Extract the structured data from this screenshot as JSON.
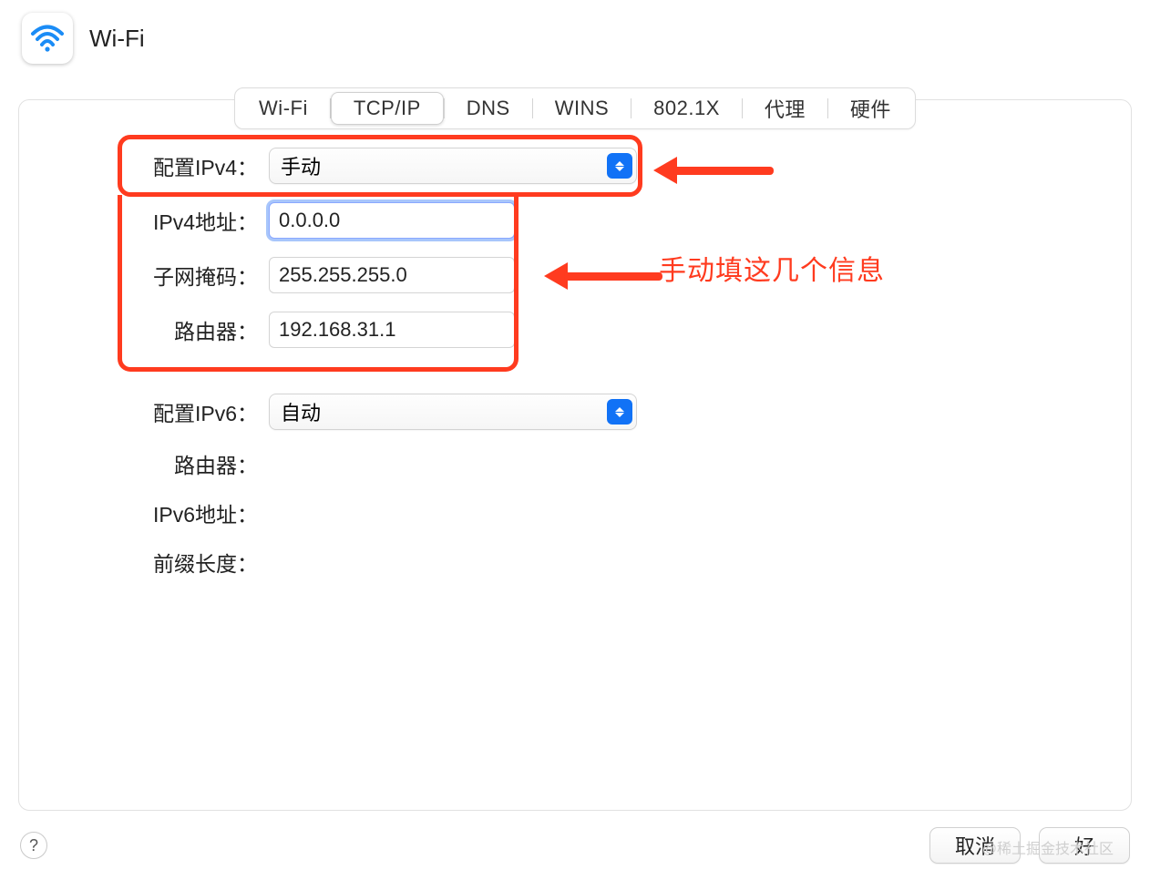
{
  "header": {
    "title": "Wi-Fi"
  },
  "tabs": {
    "items": [
      {
        "label": "Wi-Fi",
        "active": false
      },
      {
        "label": "TCP/IP",
        "active": true
      },
      {
        "label": "DNS",
        "active": false
      },
      {
        "label": "WINS",
        "active": false
      },
      {
        "label": "802.1X",
        "active": false
      },
      {
        "label": "代理",
        "active": false
      },
      {
        "label": "硬件",
        "active": false
      }
    ]
  },
  "form": {
    "configure_ipv4_label": "配置IPv4：",
    "configure_ipv4_value": "手动",
    "ipv4_address_label": "IPv4地址：",
    "ipv4_address_value": "0.0.0.0",
    "subnet_mask_label": "子网掩码：",
    "subnet_mask_value": "255.255.255.0",
    "router4_label": "路由器：",
    "router4_value": "192.168.31.1",
    "configure_ipv6_label": "配置IPv6：",
    "configure_ipv6_value": "自动",
    "router6_label": "路由器：",
    "ipv6_address_label": "IPv6地址：",
    "prefix_length_label": "前缀长度："
  },
  "annotation": "手动填这几个信息",
  "footer": {
    "help": "?",
    "cancel": "取消",
    "ok": "好"
  },
  "watermark": "@稀土掘金技术社区"
}
